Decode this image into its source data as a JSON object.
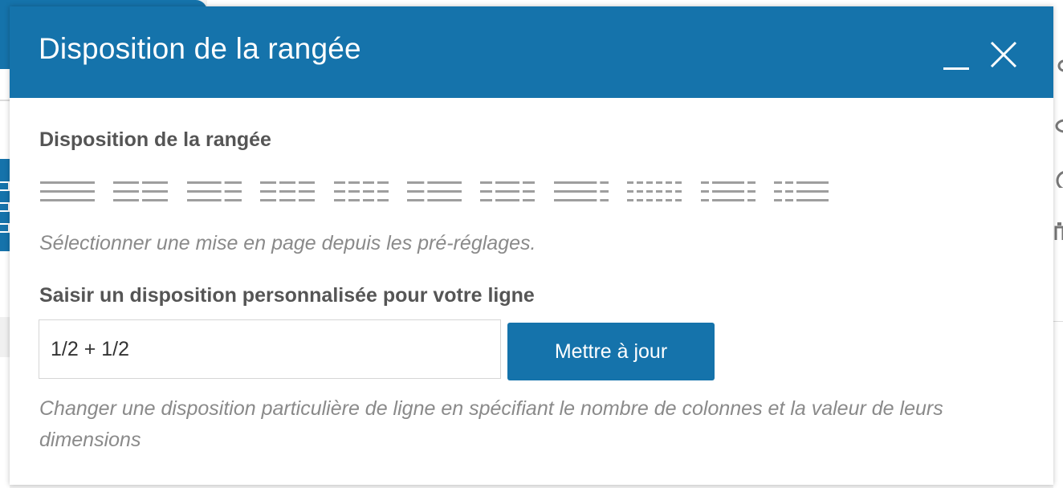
{
  "dialog": {
    "title": "Disposition de la rangée",
    "minimize_icon": "minimize-icon",
    "close_icon": "close-icon"
  },
  "presets_section": {
    "label": "Disposition de la rangée",
    "help": "Sélectionner une mise en page depuis les pré-réglages.",
    "presets": [
      {
        "name": "1 column",
        "columns": [
          1
        ]
      },
      {
        "name": "1/2 + 1/2",
        "columns": [
          1,
          1
        ]
      },
      {
        "name": "2/3 + 1/3",
        "columns": [
          2,
          1
        ]
      },
      {
        "name": "1/3 + 1/3 + 1/3",
        "columns": [
          1,
          1,
          1
        ]
      },
      {
        "name": "1/4 x 4",
        "columns": [
          1,
          1,
          1,
          1
        ]
      },
      {
        "name": "1/3 + 2/3",
        "columns": [
          1,
          2
        ]
      },
      {
        "name": "1/4 + 1/2 + 1/4",
        "columns": [
          1,
          2,
          1
        ]
      },
      {
        "name": "5/6 + 1/6",
        "columns": [
          5,
          1
        ]
      },
      {
        "name": "1/6 x 6",
        "columns": [
          1,
          1,
          1,
          1,
          1,
          1
        ]
      },
      {
        "name": "1/6 + 4/6 + 1/6",
        "columns": [
          1,
          4,
          1
        ]
      },
      {
        "name": "1/6 + 1/6 + 4/6",
        "columns": [
          1,
          1,
          4
        ]
      }
    ]
  },
  "custom_section": {
    "label": "Saisir un disposition personnalisée pour votre ligne",
    "input_value": "1/2 + 1/2",
    "button_label": "Mettre à jour",
    "help": "Changer une disposition particulière de ligne en spécifiant le nombre de colonnes et la valeur de leurs dimensions"
  },
  "colors": {
    "accent": "#1573ab",
    "preset_bars": "#9e9e9e",
    "help_text": "#8a8a8a",
    "label_text": "#555555"
  }
}
